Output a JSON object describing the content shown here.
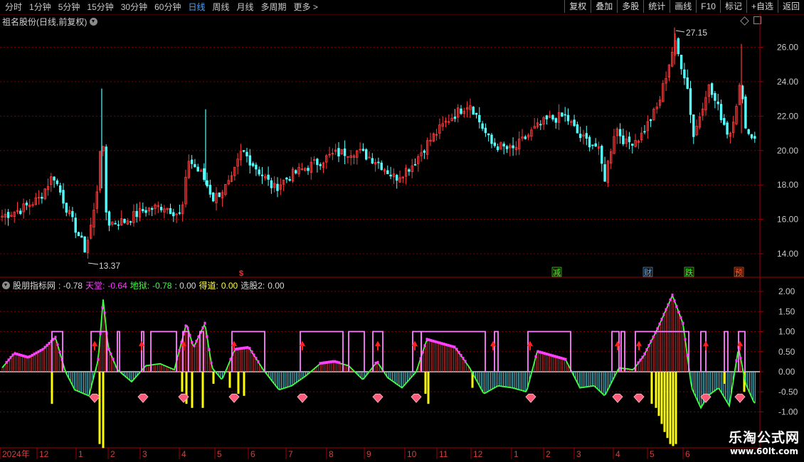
{
  "toolbar": {
    "tabs": [
      "分时",
      "1分钟",
      "5分钟",
      "15分钟",
      "30分钟",
      "60分钟",
      "日线",
      "周线",
      "月线",
      "多周期",
      "更多 >"
    ],
    "active_tab": "日线",
    "right_buttons": [
      "复权",
      "叠加",
      "多股",
      "统计",
      "画线",
      "F10",
      "标记",
      "+自选",
      "返回"
    ]
  },
  "main_title": "祖名股份(日线,前复权)",
  "price_axis": [
    "26.00",
    "24.00",
    "22.00",
    "20.00",
    "18.00",
    "16.00",
    "14.00"
  ],
  "high_label": "27.15",
  "low_label": "13.37",
  "event_markers": [
    "减",
    "财",
    "跌",
    "预"
  ],
  "s_marker": "$",
  "indicator": {
    "name": "股朋指标网",
    "value": ": -0.78",
    "tiantang_label": "天堂:",
    "tiantang_value": "-0.64",
    "diyu_label": "地狱:",
    "diyu_value": "-0.78",
    "blank_value": ": 0.00",
    "dedao_label": "得道:",
    "dedao_value": "0.00",
    "xuangu_label": "选股2:",
    "xuangu_value": "0.00"
  },
  "indicator_axis": [
    "2.00",
    "1.50",
    "1.00",
    "0.50",
    "0.00",
    "-0.50",
    "-1.00"
  ],
  "date_axis": [
    "2024年",
    "12",
    "1",
    "2",
    "3",
    "4",
    "5",
    "6",
    "7",
    "8",
    "9",
    "10",
    "11",
    "12",
    "1",
    "2",
    "3",
    "4",
    "5",
    "6"
  ],
  "watermark": {
    "line1": "乐淘公式网",
    "line2": "www.60lt.com"
  },
  "colors": {
    "up": "#ff3a3a",
    "down": "#54ffff",
    "grid": "#800000",
    "pink": "#ff40ff",
    "green": "#40ff40",
    "yellow": "#ffff00",
    "orchid": "#ff80ff"
  }
}
